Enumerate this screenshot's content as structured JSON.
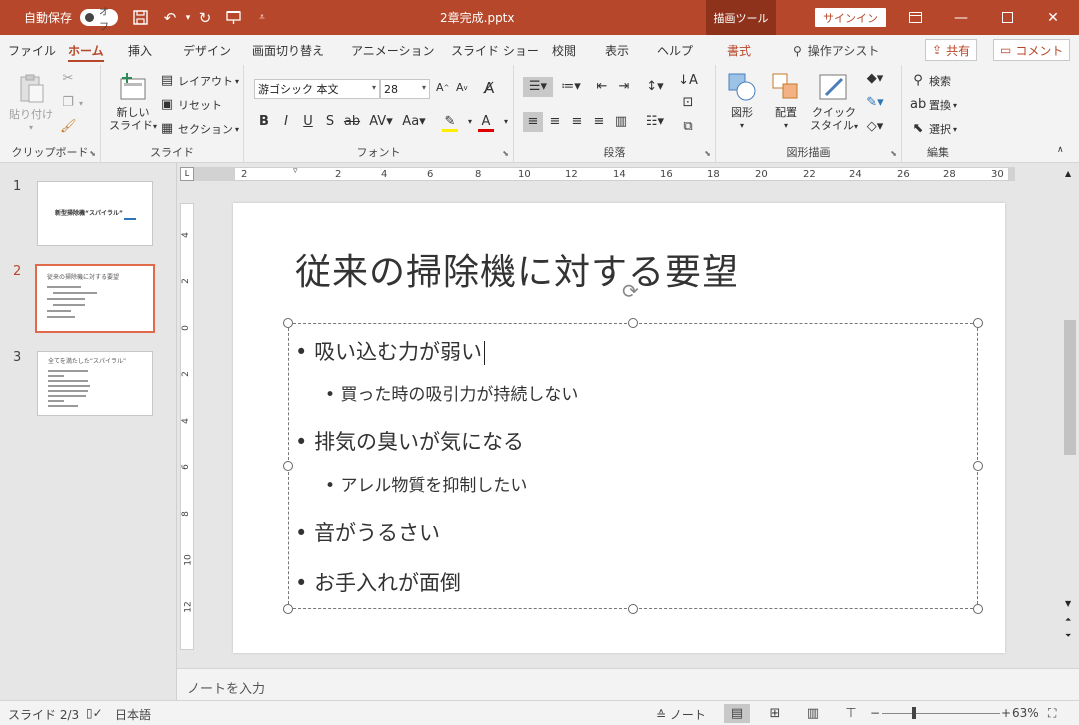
{
  "titlebar": {
    "autosave_label": "自動保存",
    "autosave_state": "オフ",
    "doc_title": "2章完成.pptx",
    "tool_tab": "描画ツール",
    "signin_label": "サインイン"
  },
  "tabs": [
    {
      "label": "ファイル"
    },
    {
      "label": "ホーム"
    },
    {
      "label": "挿入"
    },
    {
      "label": "デザイン"
    },
    {
      "label": "画面切り替え"
    },
    {
      "label": "アニメーション"
    },
    {
      "label": "スライド ショー"
    },
    {
      "label": "校閲"
    },
    {
      "label": "表示"
    },
    {
      "label": "ヘルプ"
    },
    {
      "label": "書式"
    }
  ],
  "tellme_label": "操作アシスト",
  "share_label": "共有",
  "comment_label": "コメント",
  "ribbon": {
    "clipboard": {
      "label": "クリップボード",
      "paste": "貼り付け"
    },
    "slides": {
      "label": "スライド",
      "new_slide_line1": "新しい",
      "new_slide_line2": "スライド",
      "layout": "レイアウト",
      "reset": "リセット",
      "section": "セクション"
    },
    "font": {
      "label": "フォント",
      "font_name": "游ゴシック 本文",
      "font_size": "28"
    },
    "paragraph": {
      "label": "段落"
    },
    "drawing": {
      "label": "図形描画",
      "shapes": "図形",
      "arrange": "配置",
      "quick_style_line1": "クイック",
      "quick_style_line2": "スタイル"
    },
    "editing": {
      "label": "編集",
      "find": "検索",
      "replace": "置換",
      "select": "選択"
    }
  },
  "ruler": {
    "h_labels": [
      "2",
      "2",
      "4",
      "6",
      "8",
      "10",
      "12",
      "14",
      "16",
      "18",
      "20",
      "22",
      "24",
      "26",
      "28",
      "30"
    ],
    "v_labels": [
      "4",
      "2",
      "0",
      "2",
      "4",
      "6",
      "8",
      "10",
      "12"
    ]
  },
  "thumbnails": [
    {
      "num": "1",
      "title": "新型掃除機“スパイラル”"
    },
    {
      "num": "2",
      "title": "従来の掃除機に対する要望"
    },
    {
      "num": "3",
      "title": "全てを満たした“スパイラル”"
    }
  ],
  "slide": {
    "title": "従来の掃除機に対する要望",
    "bullets": [
      {
        "level": 1,
        "text": "吸い込む力が弱い"
      },
      {
        "level": 2,
        "text": "買った時の吸引力が持続しない"
      },
      {
        "level": 1,
        "text": "排気の臭いが気になる"
      },
      {
        "level": 2,
        "text": "アレル物質を抑制したい"
      },
      {
        "level": 1,
        "text": "音がうるさい"
      },
      {
        "level": 1,
        "text": "お手入れが面倒"
      }
    ]
  },
  "notes_placeholder": "ノートを入力",
  "status": {
    "slide_pos": "スライド 2/3",
    "language": "日本語",
    "notes_label": "ノート",
    "zoom": "63%"
  }
}
